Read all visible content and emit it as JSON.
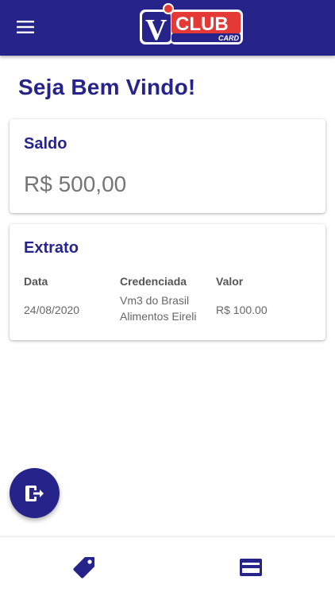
{
  "app": {
    "logo_text": "CLUB",
    "logo_sub": "CARD",
    "logo_letter": "V",
    "colors": {
      "primary": "#26248a",
      "logo_red": "#e53935"
    }
  },
  "header": {
    "menu_icon": "menu-icon"
  },
  "welcome": {
    "title": "Seja Bem Vindo!"
  },
  "saldo": {
    "title": "Saldo",
    "value": "R$ 500,00"
  },
  "extrato": {
    "title": "Extrato",
    "columns": [
      "Data",
      "Credenciada",
      "Valor"
    ],
    "rows": [
      {
        "data": "24/08/2020",
        "credenciada_l1": "Vm3 do Brasil",
        "credenciada_l2": "Alimentos Eireli",
        "valor": "R$ 100.00"
      }
    ]
  },
  "fab": {
    "icon": "logout-icon"
  },
  "bottom_nav": {
    "items": [
      {
        "icon": "tag-icon"
      },
      {
        "icon": "credit-card-icon"
      }
    ]
  }
}
